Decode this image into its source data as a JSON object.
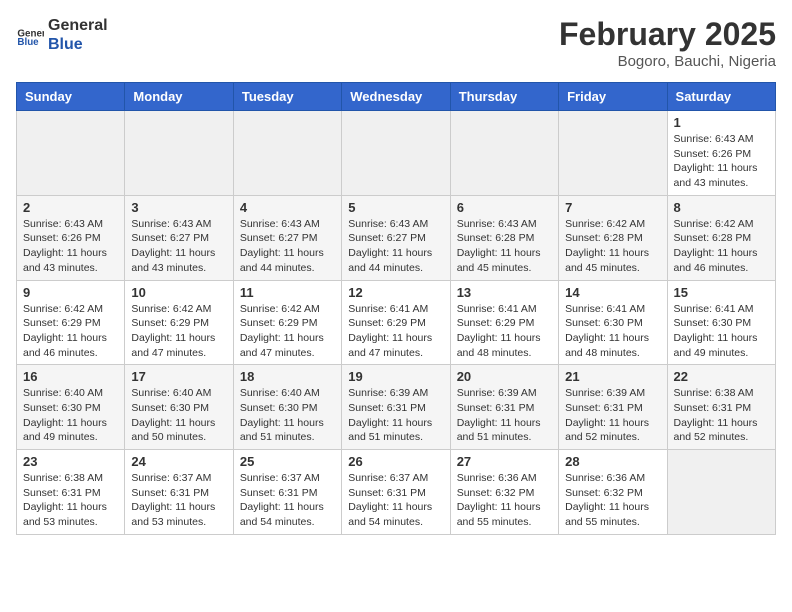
{
  "header": {
    "logo_general": "General",
    "logo_blue": "Blue",
    "month_title": "February 2025",
    "location": "Bogoro, Bauchi, Nigeria"
  },
  "days_of_week": [
    "Sunday",
    "Monday",
    "Tuesday",
    "Wednesday",
    "Thursday",
    "Friday",
    "Saturday"
  ],
  "weeks": [
    [
      {
        "day": "",
        "info": ""
      },
      {
        "day": "",
        "info": ""
      },
      {
        "day": "",
        "info": ""
      },
      {
        "day": "",
        "info": ""
      },
      {
        "day": "",
        "info": ""
      },
      {
        "day": "",
        "info": ""
      },
      {
        "day": "1",
        "info": "Sunrise: 6:43 AM\nSunset: 6:26 PM\nDaylight: 11 hours and 43 minutes."
      }
    ],
    [
      {
        "day": "2",
        "info": "Sunrise: 6:43 AM\nSunset: 6:26 PM\nDaylight: 11 hours and 43 minutes."
      },
      {
        "day": "3",
        "info": "Sunrise: 6:43 AM\nSunset: 6:27 PM\nDaylight: 11 hours and 43 minutes."
      },
      {
        "day": "4",
        "info": "Sunrise: 6:43 AM\nSunset: 6:27 PM\nDaylight: 11 hours and 44 minutes."
      },
      {
        "day": "5",
        "info": "Sunrise: 6:43 AM\nSunset: 6:27 PM\nDaylight: 11 hours and 44 minutes."
      },
      {
        "day": "6",
        "info": "Sunrise: 6:43 AM\nSunset: 6:28 PM\nDaylight: 11 hours and 45 minutes."
      },
      {
        "day": "7",
        "info": "Sunrise: 6:42 AM\nSunset: 6:28 PM\nDaylight: 11 hours and 45 minutes."
      },
      {
        "day": "8",
        "info": "Sunrise: 6:42 AM\nSunset: 6:28 PM\nDaylight: 11 hours and 46 minutes."
      }
    ],
    [
      {
        "day": "9",
        "info": "Sunrise: 6:42 AM\nSunset: 6:29 PM\nDaylight: 11 hours and 46 minutes."
      },
      {
        "day": "10",
        "info": "Sunrise: 6:42 AM\nSunset: 6:29 PM\nDaylight: 11 hours and 47 minutes."
      },
      {
        "day": "11",
        "info": "Sunrise: 6:42 AM\nSunset: 6:29 PM\nDaylight: 11 hours and 47 minutes."
      },
      {
        "day": "12",
        "info": "Sunrise: 6:41 AM\nSunset: 6:29 PM\nDaylight: 11 hours and 47 minutes."
      },
      {
        "day": "13",
        "info": "Sunrise: 6:41 AM\nSunset: 6:29 PM\nDaylight: 11 hours and 48 minutes."
      },
      {
        "day": "14",
        "info": "Sunrise: 6:41 AM\nSunset: 6:30 PM\nDaylight: 11 hours and 48 minutes."
      },
      {
        "day": "15",
        "info": "Sunrise: 6:41 AM\nSunset: 6:30 PM\nDaylight: 11 hours and 49 minutes."
      }
    ],
    [
      {
        "day": "16",
        "info": "Sunrise: 6:40 AM\nSunset: 6:30 PM\nDaylight: 11 hours and 49 minutes."
      },
      {
        "day": "17",
        "info": "Sunrise: 6:40 AM\nSunset: 6:30 PM\nDaylight: 11 hours and 50 minutes."
      },
      {
        "day": "18",
        "info": "Sunrise: 6:40 AM\nSunset: 6:30 PM\nDaylight: 11 hours and 51 minutes."
      },
      {
        "day": "19",
        "info": "Sunrise: 6:39 AM\nSunset: 6:31 PM\nDaylight: 11 hours and 51 minutes."
      },
      {
        "day": "20",
        "info": "Sunrise: 6:39 AM\nSunset: 6:31 PM\nDaylight: 11 hours and 51 minutes."
      },
      {
        "day": "21",
        "info": "Sunrise: 6:39 AM\nSunset: 6:31 PM\nDaylight: 11 hours and 52 minutes."
      },
      {
        "day": "22",
        "info": "Sunrise: 6:38 AM\nSunset: 6:31 PM\nDaylight: 11 hours and 52 minutes."
      }
    ],
    [
      {
        "day": "23",
        "info": "Sunrise: 6:38 AM\nSunset: 6:31 PM\nDaylight: 11 hours and 53 minutes."
      },
      {
        "day": "24",
        "info": "Sunrise: 6:37 AM\nSunset: 6:31 PM\nDaylight: 11 hours and 53 minutes."
      },
      {
        "day": "25",
        "info": "Sunrise: 6:37 AM\nSunset: 6:31 PM\nDaylight: 11 hours and 54 minutes."
      },
      {
        "day": "26",
        "info": "Sunrise: 6:37 AM\nSunset: 6:31 PM\nDaylight: 11 hours and 54 minutes."
      },
      {
        "day": "27",
        "info": "Sunrise: 6:36 AM\nSunset: 6:32 PM\nDaylight: 11 hours and 55 minutes."
      },
      {
        "day": "28",
        "info": "Sunrise: 6:36 AM\nSunset: 6:32 PM\nDaylight: 11 hours and 55 minutes."
      },
      {
        "day": "",
        "info": ""
      }
    ]
  ]
}
